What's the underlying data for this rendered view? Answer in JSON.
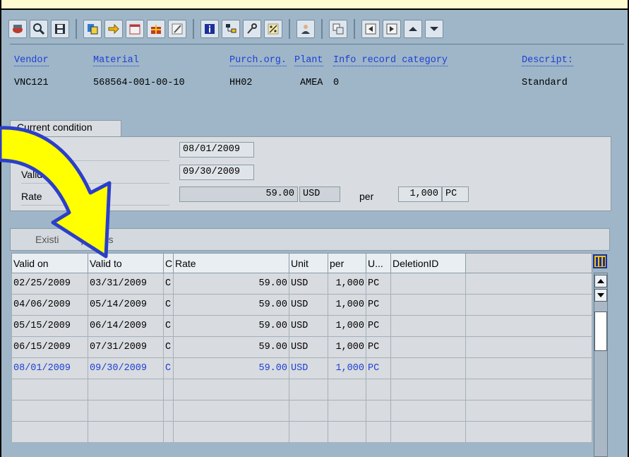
{
  "toolbar": {
    "buttons": [
      {
        "icon": "display-icon"
      },
      {
        "icon": "find-icon"
      },
      {
        "icon": "save-icon"
      },
      {
        "icon": "copy-icon"
      },
      {
        "icon": "goto-icon"
      },
      {
        "icon": "calendar-icon"
      },
      {
        "icon": "gift-icon"
      },
      {
        "icon": "edit-icon"
      },
      {
        "icon": "info-icon"
      },
      {
        "icon": "hierarchy-icon"
      },
      {
        "icon": "key-icon"
      },
      {
        "icon": "percent-icon"
      },
      {
        "icon": "user-icon"
      },
      {
        "icon": "transfer-icon"
      },
      {
        "icon": "first-page-icon"
      },
      {
        "icon": "last-page-icon"
      },
      {
        "icon": "up-icon"
      },
      {
        "icon": "down-icon"
      }
    ]
  },
  "header": {
    "labels": {
      "vendor": "Vendor",
      "material": "Material",
      "purch_org": "Purch.org.",
      "plant": "Plant",
      "info_record_category": "Info record category",
      "description": "Descript:"
    },
    "values": {
      "vendor": "VNC121",
      "material": "568564-001-00-10",
      "purch_org": "HH02",
      "plant": "AMEA",
      "info_record_category": "0",
      "description": "Standard"
    }
  },
  "current_condition": {
    "title": "Current condition",
    "valid_from_label": "Va",
    "valid_to_label": "Valid",
    "rate_label": "Rate",
    "valid_from": "08/01/2009",
    "valid_to": "09/30/2009",
    "rate": "59.00",
    "currency": "USD",
    "per_label": "per",
    "per_qty": "1,000",
    "uom": "PC"
  },
  "existing_periods": {
    "title": "Existi        periods",
    "columns": [
      "Valid on",
      "Valid to",
      "C",
      "Rate",
      "Unit",
      "per",
      "U...",
      "DeletionID",
      ""
    ],
    "rows": [
      [
        "02/25/2009",
        "03/31/2009",
        "C",
        "59.00",
        "USD",
        "1,000",
        "PC",
        "",
        ""
      ],
      [
        "04/06/2009",
        "05/14/2009",
        "C",
        "59.00",
        "USD",
        "1,000",
        "PC",
        "",
        ""
      ],
      [
        "05/15/2009",
        "06/14/2009",
        "C",
        "59.00",
        "USD",
        "1,000",
        "PC",
        "",
        ""
      ],
      [
        "06/15/2009",
        "07/31/2009",
        "C",
        "59.00",
        "USD",
        "1,000",
        "PC",
        "",
        ""
      ],
      [
        "08/01/2009",
        "09/30/2009",
        "C",
        "59.00",
        "USD",
        "1,000",
        "PC",
        "",
        ""
      ],
      [
        "",
        "",
        "",
        "",
        "",
        "",
        "",
        "",
        ""
      ],
      [
        "",
        "",
        "",
        "",
        "",
        "",
        "",
        "",
        ""
      ],
      [
        "",
        "",
        "",
        "",
        "",
        "",
        "",
        "",
        ""
      ]
    ],
    "selected_row": 4
  },
  "colors": {
    "background": "#9eb6c8",
    "highlight_text": "#1d3fd6",
    "arrow_fill": "#ffff00",
    "arrow_stroke": "#2b3fc8"
  }
}
